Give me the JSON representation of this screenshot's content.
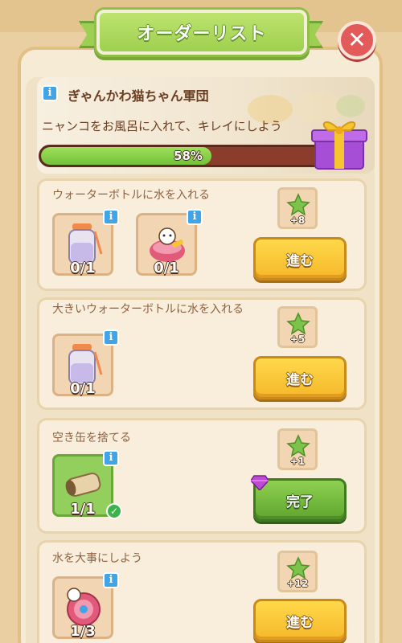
{
  "header": {
    "title": "オーダーリスト",
    "close_icon": "close-icon"
  },
  "mission": {
    "title": "ぎゃんかわ猫ちゃん軍団",
    "description": "ニャンコをお風呂に入れて、キレイにしよう",
    "progress_label": "58%",
    "progress_fraction": 0.58,
    "reward_icon": "gift-box-icon"
  },
  "tasks": [
    {
      "title": "ウォーターボトルに水を入れる",
      "items": [
        {
          "icon": "water-bottle-icon",
          "qty": "0/1",
          "done": false
        },
        {
          "icon": "cat-bath-icon",
          "qty": "0/1",
          "done": false
        }
      ],
      "reward": "+8",
      "button": "進む",
      "button_state": "go"
    },
    {
      "title": "大きいウォーターボトルに水を入れる",
      "items": [
        {
          "icon": "water-bottle-icon",
          "qty": "0/1",
          "done": false
        }
      ],
      "reward": "+5",
      "button": "進む",
      "button_state": "go"
    },
    {
      "title": "空き缶を捨てる",
      "items": [
        {
          "icon": "empty-can-icon",
          "qty": "1/1",
          "done": true
        }
      ],
      "reward": "+1",
      "button": "完了",
      "button_state": "complete"
    },
    {
      "title": "水を大事にしよう",
      "items": [
        {
          "icon": "cat-hose-icon",
          "qty": "1/3",
          "done": false
        }
      ],
      "reward": "+12",
      "button": "進む",
      "button_state": "go"
    }
  ],
  "colors": {
    "banner_green": "#9fd04f",
    "button_yellow": "#f5b82a",
    "button_green": "#5ea62e",
    "progress_green": "#72c23a",
    "progress_track": "#8a3d2a",
    "text_brown": "#6a3e23"
  }
}
